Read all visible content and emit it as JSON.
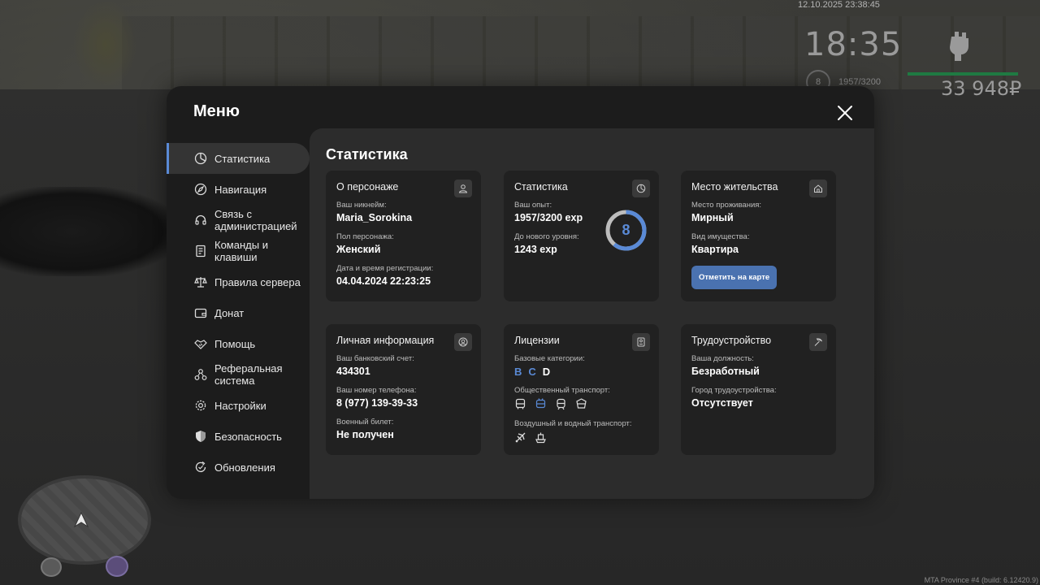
{
  "hud": {
    "datetime": "12.10.2025 23:38:45",
    "clock": "18:35",
    "level": "8",
    "exp": "1957/3200",
    "money": "33 948₽",
    "build": "MTA Province #4 (build: 6.12420.9)"
  },
  "menu": {
    "title": "Меню",
    "sidebar": [
      {
        "label": "Статистика",
        "icon": "pie-chart-icon",
        "active": true
      },
      {
        "label": "Навигация",
        "icon": "compass-icon"
      },
      {
        "label": "Связь с администрацией",
        "icon": "headset-icon"
      },
      {
        "label": "Команды и клавиши",
        "icon": "document-icon"
      },
      {
        "label": "Правила сервера",
        "icon": "scales-icon"
      },
      {
        "label": "Донат",
        "icon": "wallet-icon"
      },
      {
        "label": "Помощь",
        "icon": "handshake-icon"
      },
      {
        "label": "Реферальная система",
        "icon": "network-icon"
      },
      {
        "label": "Настройки",
        "icon": "gear-icon"
      },
      {
        "label": "Безопасность",
        "icon": "shield-icon"
      },
      {
        "label": "Обновления",
        "icon": "refresh-icon"
      }
    ]
  },
  "content": {
    "title": "Статистика",
    "character": {
      "title": "О персонаже",
      "nickname_label": "Ваш никнейм:",
      "nickname": "Maria_Sorokina",
      "gender_label": "Пол персонажа:",
      "gender": "Женский",
      "reg_label": "Дата и время регистрации:",
      "reg": "04.04.2024 22:23:25"
    },
    "stats": {
      "title": "Статистика",
      "exp_label": "Ваш опыт:",
      "exp": "1957/3200 exp",
      "next_label": "До нового уровня:",
      "next": "1243 exp",
      "level": "8",
      "progress": 0.61
    },
    "residence": {
      "title": "Место жительства",
      "place_label": "Место проживания:",
      "place": "Мирный",
      "property_label": "Вид имущества:",
      "property": "Квартира",
      "button": "Отметить на карте"
    },
    "personal": {
      "title": "Личная информация",
      "bank_label": "Ваш банковский счет:",
      "bank": "434301",
      "phone_label": "Ваш номер телефона:",
      "phone": "8 (977) 139-39-33",
      "military_label": "Военный билет:",
      "military": "Не получен"
    },
    "licenses": {
      "title": "Лицензии",
      "base_label": "Базовые категории:",
      "categories": [
        "B",
        "C",
        "D"
      ],
      "public_label": "Общественный транспорт:",
      "air_label": "Воздушный и водный транспорт:"
    },
    "employment": {
      "title": "Трудоустройство",
      "position_label": "Ваша должность:",
      "position": "Безработный",
      "city_label": "Город трудоустройства:",
      "city": "Отсутствует"
    }
  },
  "colors": {
    "accent": "#5a8ad6",
    "button": "#4a72b0",
    "health": "#1f7a42"
  }
}
